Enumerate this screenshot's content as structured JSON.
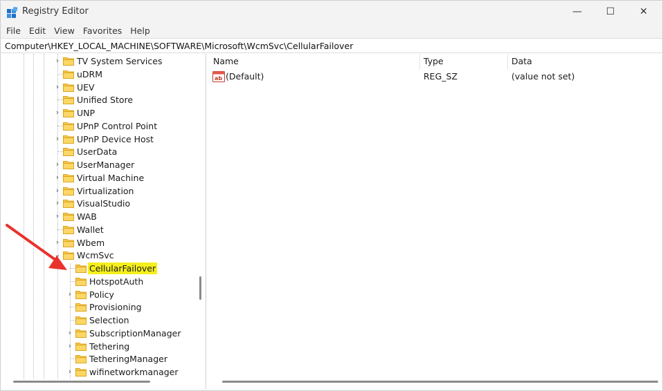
{
  "window": {
    "title": "Registry Editor",
    "controls": {
      "minimize": "—",
      "maximize": "☐",
      "close": "✕"
    }
  },
  "menu": [
    "File",
    "Edit",
    "View",
    "Favorites",
    "Help"
  ],
  "address": "Computer\\HKEY_LOCAL_MACHINE\\SOFTWARE\\Microsoft\\WcmSvc\\CellularFailover",
  "tree": {
    "items": [
      {
        "label": "TV System Services",
        "expandable": true,
        "level": 1
      },
      {
        "label": "uDRM",
        "expandable": false,
        "level": 1
      },
      {
        "label": "UEV",
        "expandable": true,
        "level": 1
      },
      {
        "label": "Unified Store",
        "expandable": false,
        "level": 1
      },
      {
        "label": "UNP",
        "expandable": true,
        "level": 1
      },
      {
        "label": "UPnP Control Point",
        "expandable": false,
        "level": 1
      },
      {
        "label": "UPnP Device Host",
        "expandable": true,
        "level": 1
      },
      {
        "label": "UserData",
        "expandable": false,
        "level": 1
      },
      {
        "label": "UserManager",
        "expandable": true,
        "level": 1
      },
      {
        "label": "Virtual Machine",
        "expandable": true,
        "level": 1
      },
      {
        "label": "Virtualization",
        "expandable": true,
        "level": 1
      },
      {
        "label": "VisualStudio",
        "expandable": true,
        "level": 1
      },
      {
        "label": "WAB",
        "expandable": true,
        "level": 1
      },
      {
        "label": "Wallet",
        "expandable": false,
        "level": 1
      },
      {
        "label": "Wbem",
        "expandable": true,
        "level": 1
      },
      {
        "label": "WcmSvc",
        "expandable": true,
        "expanded": true,
        "level": 1
      },
      {
        "label": "CellularFailover",
        "expandable": false,
        "level": 2,
        "selected": true
      },
      {
        "label": "HotspotAuth",
        "expandable": false,
        "level": 2
      },
      {
        "label": "Policy",
        "expandable": true,
        "level": 2
      },
      {
        "label": "Provisioning",
        "expandable": false,
        "level": 2
      },
      {
        "label": "Selection",
        "expandable": false,
        "level": 2
      },
      {
        "label": "SubscriptionManager",
        "expandable": true,
        "level": 2
      },
      {
        "label": "Tethering",
        "expandable": true,
        "level": 2
      },
      {
        "label": "TetheringManager",
        "expandable": false,
        "level": 2
      },
      {
        "label": "wifinetworkmanager",
        "expandable": true,
        "level": 2
      }
    ]
  },
  "list": {
    "columns": {
      "name": "Name",
      "type": "Type",
      "data": "Data"
    },
    "rows": [
      {
        "icon": "string-value-icon",
        "name": "(Default)",
        "type": "REG_SZ",
        "data": "(value not set)"
      }
    ]
  },
  "annotation": {
    "arrow_color": "#e8322b",
    "highlight_color": "#f5ef1c"
  }
}
